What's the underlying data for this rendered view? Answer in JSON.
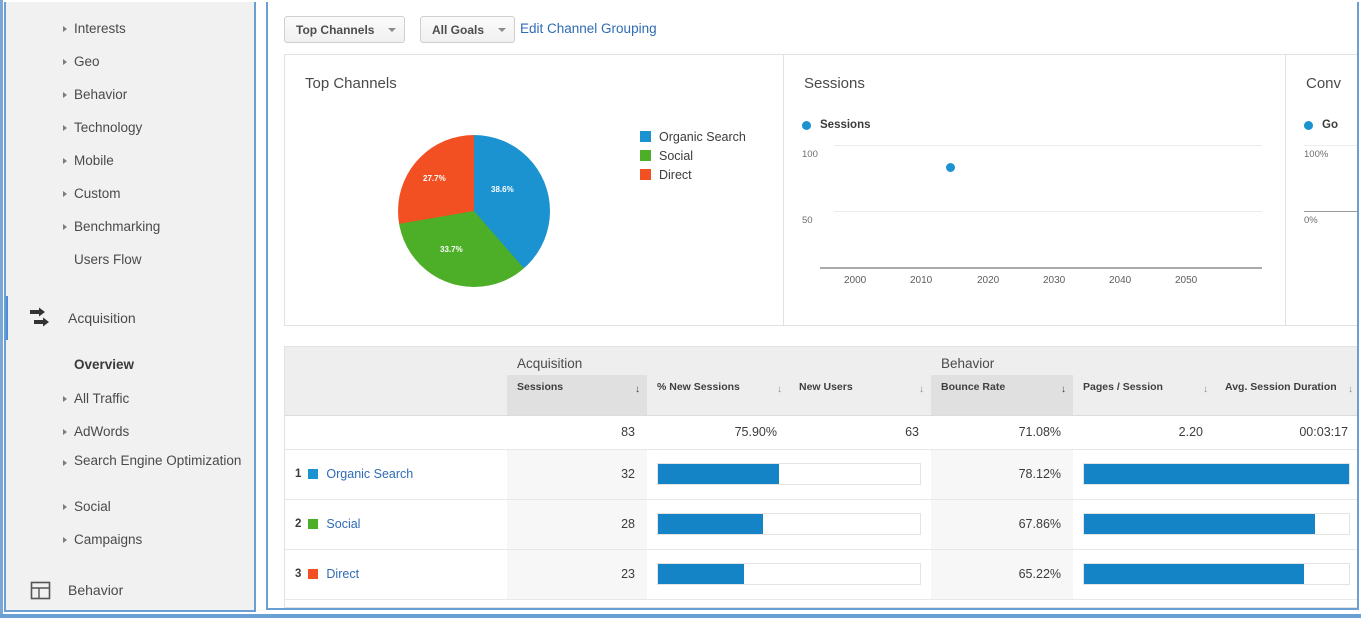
{
  "sidebar": {
    "items": [
      {
        "label": "Interests",
        "type": "sub",
        "expandable": true
      },
      {
        "label": "Geo",
        "type": "sub",
        "expandable": true
      },
      {
        "label": "Behavior",
        "type": "sub",
        "expandable": true
      },
      {
        "label": "Technology",
        "type": "sub",
        "expandable": true
      },
      {
        "label": "Mobile",
        "type": "sub",
        "expandable": true
      },
      {
        "label": "Custom",
        "type": "sub",
        "expandable": true
      },
      {
        "label": "Benchmarking",
        "type": "sub",
        "expandable": true
      },
      {
        "label": "Users Flow",
        "type": "sub",
        "expandable": false
      }
    ],
    "acquisition_section": {
      "label": "Acquisition",
      "icon": "acquisition-arrows-icon",
      "active": true
    },
    "acquisition_items": [
      {
        "label": "Overview",
        "type": "sub",
        "expandable": false,
        "selected": true
      },
      {
        "label": "All Traffic",
        "type": "sub",
        "expandable": true
      },
      {
        "label": "AdWords",
        "type": "sub",
        "expandable": true
      },
      {
        "label": "Search Engine Optimization",
        "type": "sub",
        "expandable": true,
        "two_line": true
      },
      {
        "label": "Social",
        "type": "sub",
        "expandable": true
      },
      {
        "label": "Campaigns",
        "type": "sub",
        "expandable": true
      }
    ],
    "behavior_section": {
      "label": "Behavior",
      "icon": "layout-page-icon",
      "active": false
    }
  },
  "toolbar": {
    "channel_grouping_label": "Top Channels",
    "goals_label": "All Goals",
    "edit_link_label": "Edit Channel Grouping"
  },
  "widgets": {
    "channels": {
      "title": "Top Channels"
    },
    "sessions": {
      "title": "Sessions"
    },
    "conversions": {
      "title": "Conv",
      "legend": "Go",
      "y_ticks": [
        "100%",
        "0%"
      ]
    }
  },
  "colors": {
    "organic_search": "#1c93d1",
    "social": "#4caf27",
    "direct": "#f25022",
    "bar_blue": "#1484c6",
    "link_blue": "#2f6bb5",
    "accent_border": "#6a9fd4"
  },
  "chart_data": [
    {
      "type": "pie",
      "title": "Top Channels",
      "labels": [
        "Organic Search",
        "Social",
        "Direct"
      ],
      "values": [
        38.6,
        33.7,
        27.7
      ],
      "value_labels": [
        "38.6%",
        "33.7%",
        "27.7%"
      ],
      "colors": [
        "#1c93d1",
        "#4caf27",
        "#f25022"
      ],
      "legend_position": "right"
    },
    {
      "type": "scatter",
      "title": "Sessions",
      "legend": [
        "Sessions"
      ],
      "series": [
        {
          "name": "Sessions",
          "x": [
            2014
          ],
          "values": [
            83
          ],
          "color": "#1c93d1"
        }
      ],
      "xlabel": "",
      "ylabel": "",
      "x_ticks": [
        "2000",
        "2010",
        "2020",
        "2030",
        "2040",
        "2050"
      ],
      "y_ticks": [
        "100",
        "50"
      ],
      "ylim": [
        0,
        110
      ],
      "xlim": [
        1995,
        2058
      ],
      "grid": true,
      "legend_position": "top-left"
    },
    {
      "type": "scatter",
      "title": "Conv",
      "legend": [
        "Go"
      ],
      "y_ticks": [
        "100%",
        "0%"
      ],
      "series": [],
      "grid": true,
      "clipped": true,
      "legend_position": "top-left"
    }
  ],
  "table": {
    "group_headers": [
      {
        "label": "",
        "span": 1
      },
      {
        "label": "Acquisition",
        "span": 3
      },
      {
        "label": "Behavior",
        "span": 3
      }
    ],
    "columns": [
      {
        "label": "",
        "sorted": false
      },
      {
        "label": "Sessions",
        "sorted": true,
        "sort_arrow": "↓"
      },
      {
        "label": "% New Sessions",
        "sorted": false,
        "sort_arrow": "↓"
      },
      {
        "label": "New Users",
        "sorted": false,
        "sort_arrow": "↓"
      },
      {
        "label": "Bounce Rate",
        "sorted": true,
        "sort_arrow": "↓"
      },
      {
        "label": "Pages / Session",
        "sorted": false,
        "sort_arrow": "↓"
      },
      {
        "label": "Avg. Session Duration",
        "sorted": false,
        "sort_arrow": "↓"
      }
    ],
    "totals": {
      "sessions": "83",
      "new_sessions_pct": "75.90%",
      "new_users": "63",
      "bounce_rate": "71.08%",
      "pages_per_session": "2.20",
      "avg_session_duration": "00:03:17"
    },
    "rows": [
      {
        "rank": "1",
        "name": "Organic Search",
        "swatch": "#1c93d1",
        "sessions": "32",
        "sessions_bar_pct": 46,
        "bounce_rate": "78.12%",
        "bounce_bar_pct": 100
      },
      {
        "rank": "2",
        "name": "Social",
        "swatch": "#4caf27",
        "sessions": "28",
        "sessions_bar_pct": 40,
        "bounce_bar_pct": 87,
        "bounce_rate": "67.86%"
      },
      {
        "rank": "3",
        "name": "Direct",
        "swatch": "#f25022",
        "sessions": "23",
        "sessions_bar_pct": 33,
        "bounce_rate": "65.22%",
        "bounce_bar_pct": 83
      }
    ]
  }
}
